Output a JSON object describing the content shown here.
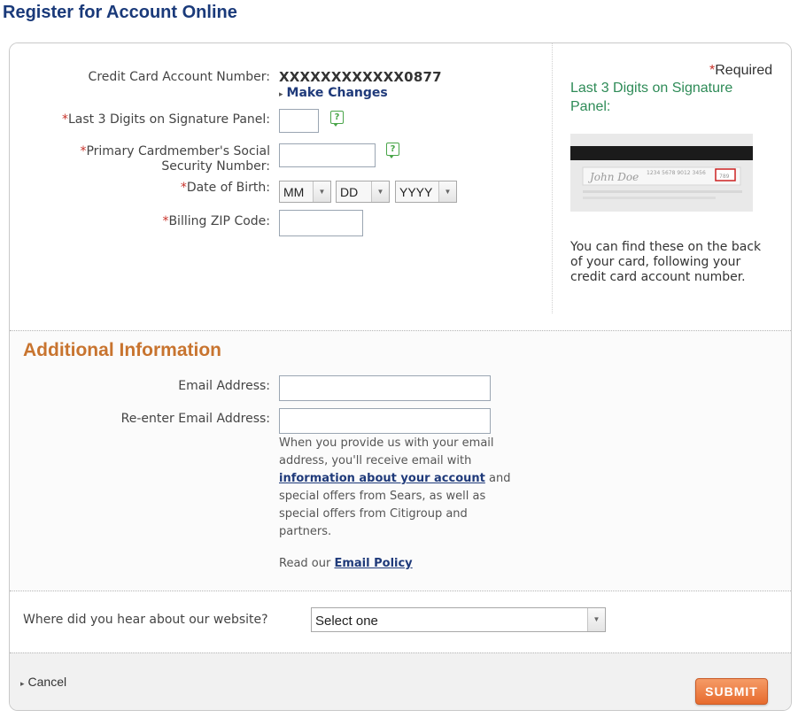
{
  "page": {
    "title": "Register for Account Online"
  },
  "required_note": {
    "star": "*",
    "label": "Required"
  },
  "form": {
    "account": {
      "label": "Credit Card Account Number:",
      "value": "XXXXXXXXXXXX0877",
      "make_changes": "Make Changes"
    },
    "sig_digits": {
      "star": "*",
      "label": "Last 3 Digits on Signature Panel:",
      "value": ""
    },
    "ssn": {
      "star": "*",
      "label_line1": "Primary Cardmember's Social",
      "label_line2": "Security Number:",
      "value": ""
    },
    "dob": {
      "star": "*",
      "label": "Date of Birth:",
      "month": "MM",
      "day": "DD",
      "year": "YYYY"
    },
    "zip": {
      "star": "*",
      "label": "Billing ZIP Code:",
      "value": ""
    }
  },
  "side": {
    "title": "Last 3 Digits on Signature Panel:",
    "card_name": "John Doe",
    "card_number": "1234 5678 9012 3456",
    "card_cvv": "789",
    "text": "You can find these on the back of your card, following your credit card account number."
  },
  "additional": {
    "heading": "Additional Information",
    "email_label": "Email Address:",
    "reemail_label": "Re-enter Email Address:",
    "note_pre": "When you provide us with your email address, you'll receive email with ",
    "note_link": "information about your account",
    "note_post": " and special offers from Sears, as well as special offers from Citigroup and partners.",
    "policy_pre": "Read our ",
    "policy_link": "Email Policy"
  },
  "hear": {
    "label": "Where did you hear about our website?",
    "selected": "Select one"
  },
  "footer": {
    "cancel": "Cancel",
    "submit": "SUBMIT"
  },
  "colors": {
    "accent_orange": "#c8742f",
    "title_blue": "#1a3a7a",
    "side_green": "#2e8b57",
    "required_red": "#c8322a"
  }
}
